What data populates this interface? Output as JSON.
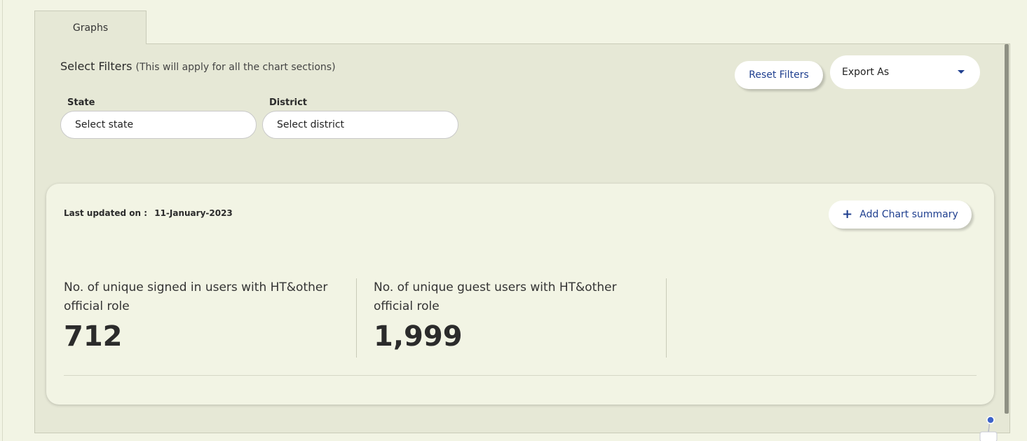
{
  "tabs": [
    {
      "label": "Graphs"
    }
  ],
  "filters": {
    "title": "Select Filters",
    "note": "(This will apply for all the chart sections)",
    "state": {
      "label": "State",
      "placeholder": "Select state"
    },
    "district": {
      "label": "District",
      "placeholder": "Select district"
    },
    "reset_label": "Reset Filters",
    "export_label": "Export As"
  },
  "card": {
    "updated_label": "Last updated on :",
    "updated_date": "11-January-2023",
    "add_summary_label": "Add Chart summary",
    "metrics": [
      {
        "label": "No. of unique signed in users with HT&other official role",
        "value": "712"
      },
      {
        "label": "No. of unique guest users with HT&other official role",
        "value": "1,999"
      }
    ]
  },
  "colors": {
    "background": "#f2f4e4",
    "panel": "#e6e8d6",
    "accent": "#1f3f8f"
  }
}
